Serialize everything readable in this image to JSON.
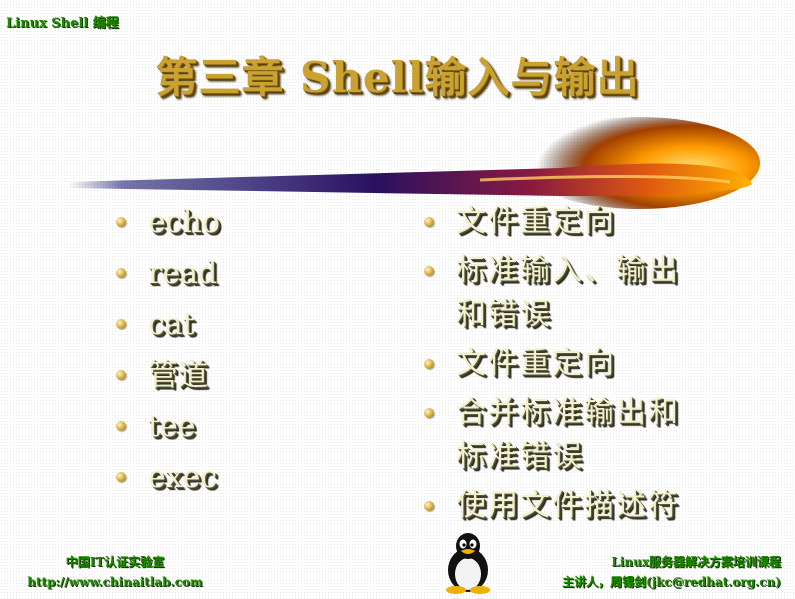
{
  "header": {
    "label": "Linux Shell 编程"
  },
  "title": "第三章 Shell输入与输出",
  "left_column": {
    "items": [
      "echo",
      "read",
      "cat",
      "管道",
      "tee",
      "exec"
    ]
  },
  "right_column": {
    "items": [
      "文件重定向",
      "标准输入、输出和错误",
      "文件重定向",
      "合并标准输出和标准错误",
      "使用文件描述符"
    ]
  },
  "footer": {
    "left_line1": "中国IT认证实验室",
    "left_line2": "http://www.chinaitlab.com",
    "right_line1": "Linux服务器解决方案培训课程",
    "right_line2": "主讲人，周锡剑(jkc@redhat.org.cn)"
  },
  "colors": {
    "accent_green": "#1f8a00",
    "title_gold": "#c9a232",
    "bullet_text": "#f3f0cc",
    "comet_orange": "#ff9a00"
  },
  "icons": [
    "bullet-icon",
    "comet-graphic",
    "tux-penguin-icon"
  ]
}
